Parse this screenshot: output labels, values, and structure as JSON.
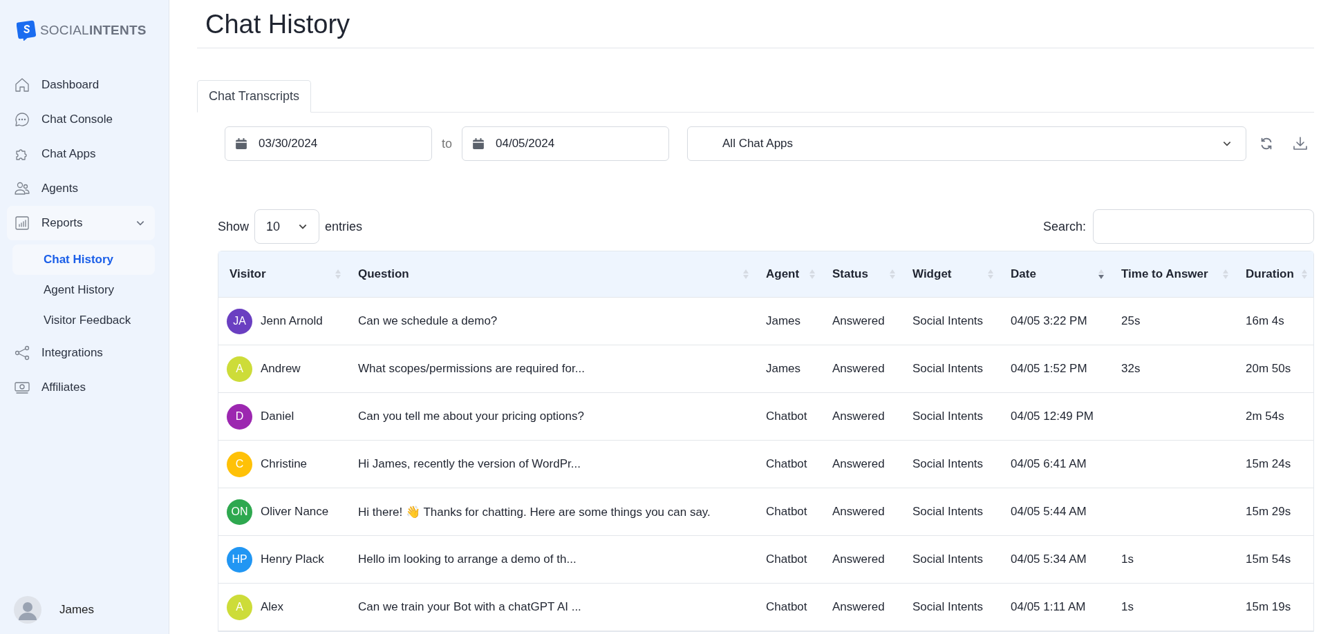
{
  "logo": {
    "text": "SOCIAL**INTENTS**"
  },
  "sidebar": {
    "items": [
      {
        "label": "Dashboard",
        "kind": "item"
      },
      {
        "label": "Chat Console",
        "kind": "item"
      },
      {
        "label": "Chat Apps",
        "kind": "item"
      },
      {
        "label": "Agents",
        "kind": "item"
      },
      {
        "label": "Reports",
        "kind": "group",
        "expanded": true,
        "children": [
          {
            "label": "Chat History",
            "selected": true
          },
          {
            "label": "Agent History",
            "selected": false
          },
          {
            "label": "Visitor Feedback",
            "selected": false
          }
        ]
      },
      {
        "label": "Integrations",
        "kind": "item"
      },
      {
        "label": "Affiliates",
        "kind": "item"
      }
    ],
    "user": {
      "name": "James"
    }
  },
  "page": {
    "title": "Chat History"
  },
  "tabs": [
    {
      "label": "Chat Transcripts",
      "selected": true
    }
  ],
  "filters": {
    "from": "03/30/2024",
    "separator": "to",
    "to": "04/05/2024",
    "app": "All Chat Apps"
  },
  "length": {
    "before": "Show",
    "value": "10",
    "after": "entries"
  },
  "search": {
    "label": "Search:"
  },
  "table": {
    "columns": [
      {
        "label": "Visitor",
        "sorted": false
      },
      {
        "label": "Question",
        "sorted": false
      },
      {
        "label": "Agent",
        "sorted": false
      },
      {
        "label": "Status",
        "sorted": false
      },
      {
        "label": "Widget",
        "sorted": false
      },
      {
        "label": "Date",
        "sorted": true
      },
      {
        "label": "Time to Answer",
        "sorted": false
      },
      {
        "label": "Duration",
        "sorted": false
      }
    ],
    "rows": [
      {
        "initials": "JA",
        "color": "#6a3fc1",
        "visitor": "Jenn Arnold",
        "question": "Can we schedule a demo?",
        "agent": "James",
        "status": "Answered",
        "widget": "Social Intents",
        "date": "04/05 3:22 PM",
        "time_to_answer": "25s",
        "duration": "16m 4s"
      },
      {
        "initials": "A",
        "color": "#cddc39",
        "visitor": "Andrew",
        "question": "What scopes/permissions are required for...",
        "agent": "James",
        "status": "Answered",
        "widget": "Social Intents",
        "date": "04/05 1:52 PM",
        "time_to_answer": "32s",
        "duration": "20m 50s"
      },
      {
        "initials": "D",
        "color": "#9c27b0",
        "visitor": "Daniel",
        "question": "Can you tell me about your pricing options?",
        "agent": "Chatbot",
        "status": "Answered",
        "widget": "Social Intents",
        "date": "04/05 12:49 PM",
        "duration": "2m 54s"
      },
      {
        "initials": "C",
        "color": "#ffc107",
        "visitor": "Christine",
        "question": "Hi James, recently the version of WordPr...",
        "agent": "Chatbot",
        "status": "Answered",
        "widget": "Social Intents",
        "date": "04/05 6:41 AM",
        "duration": "15m 24s"
      },
      {
        "initials": "ON",
        "color": "#2ea84f",
        "visitor": "Oliver Nance",
        "question": "Hi there! 👋 Thanks for chatting. Here are some things you can say.",
        "agent": "Chatbot",
        "status": "Answered",
        "widget": "Social Intents",
        "date": "04/05 5:44 AM",
        "duration": "15m 29s"
      },
      {
        "initials": "HP",
        "color": "#2196f3",
        "visitor": "Henry Plack",
        "question": "Hello im looking to arrange a demo of th...",
        "agent": "Chatbot",
        "status": "Answered",
        "widget": "Social Intents",
        "date": "04/05 5:34 AM",
        "time_to_answer": "1s",
        "duration": "15m 54s"
      },
      {
        "initials": "A",
        "color": "#cddc39",
        "visitor": "Alex",
        "question": "Can we train your Bot with a chatGPT AI ...",
        "agent": "Chatbot",
        "status": "Answered",
        "widget": "Social Intents",
        "date": "04/05 1:11 AM",
        "time_to_answer": "1s",
        "duration": "15m 19s"
      }
    ]
  }
}
